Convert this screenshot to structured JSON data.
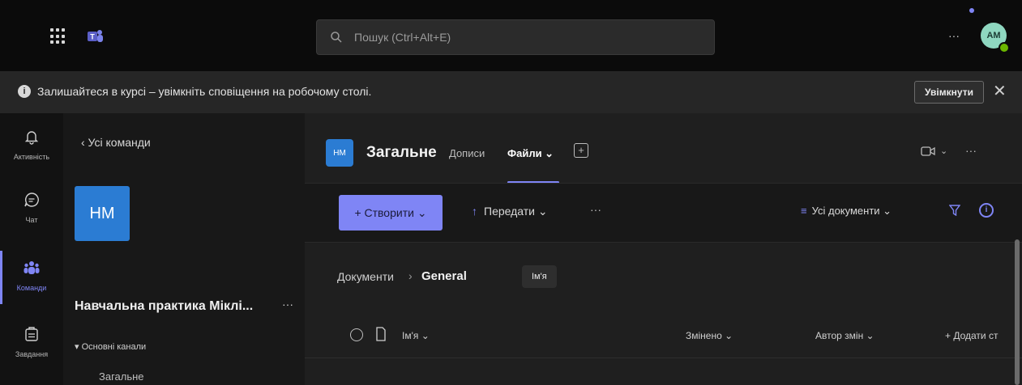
{
  "topbar": {
    "search_placeholder": "Пошук (Ctrl+Alt+E)",
    "more": "···",
    "avatar_initials": "AM"
  },
  "banner": {
    "text": "Залишайтеся в курсі – увімкніть сповіщення на робочому столі.",
    "button": "Увімкнути",
    "close": "✕"
  },
  "rail": [
    {
      "label": "Активність",
      "icon": "bell-icon"
    },
    {
      "label": "Чат",
      "icon": "chat-icon"
    },
    {
      "label": "Команди",
      "icon": "teams-icon"
    },
    {
      "label": "Завдання",
      "icon": "assignments-icon"
    }
  ],
  "teampane": {
    "back": "‹  Усі команди",
    "avatar": "НМ",
    "team_name": "Навчальна практика Міклі...",
    "more": "···",
    "channels_header": "▾ Основні канали",
    "channel": "Загальне"
  },
  "channel": {
    "avatar": "НМ",
    "title": "Загальне",
    "tabs": [
      "Дописи",
      "Файли ⌄"
    ],
    "add_tab": "+",
    "more": "···",
    "video_chev": "⌄"
  },
  "toolbar": {
    "create": "+  Створити ⌄",
    "upload": "Передати ⌄",
    "more": "···",
    "view": "Усі документи ⌄"
  },
  "breadcrumb": {
    "root": "Документи",
    "sep": "›",
    "current": "General"
  },
  "tooltip": "Ім'я",
  "columns": {
    "name": "Ім'я ⌄",
    "modified": "Змінено ⌄",
    "modified_by": "Автор змін ⌄",
    "add_column": "+ Додати ст"
  },
  "colors": {
    "accent": "#7f85f5",
    "team_blue": "#2b7cd3",
    "presence": "#6bb700"
  }
}
